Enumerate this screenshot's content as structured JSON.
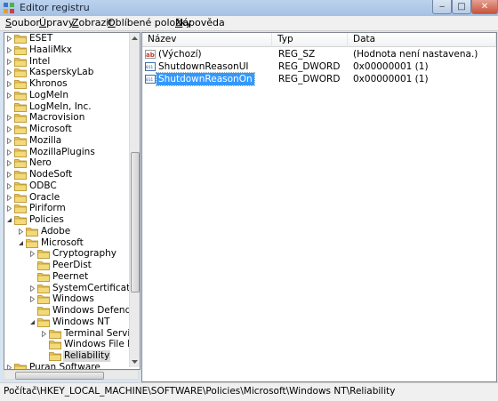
{
  "window": {
    "title": "Editor registru",
    "controls": {
      "minimize": "‒",
      "maximize": "□",
      "close": "✕"
    }
  },
  "menu": [
    {
      "pre": "",
      "u": "S",
      "post": "oubor"
    },
    {
      "pre": "",
      "u": "Ú",
      "post": "pravy"
    },
    {
      "pre": "",
      "u": "Z",
      "post": "obrazit"
    },
    {
      "pre": "",
      "u": "O",
      "post": "blíbené položky"
    },
    {
      "pre": "",
      "u": "N",
      "post": "ápověda"
    }
  ],
  "tree": [
    {
      "label": "ESET",
      "indent": 0,
      "expander": "collapsed",
      "selected": false
    },
    {
      "label": "HaaliMkx",
      "indent": 0,
      "expander": "collapsed",
      "selected": false
    },
    {
      "label": "Intel",
      "indent": 0,
      "expander": "collapsed",
      "selected": false
    },
    {
      "label": "KasperskyLab",
      "indent": 0,
      "expander": "collapsed",
      "selected": false
    },
    {
      "label": "Khronos",
      "indent": 0,
      "expander": "collapsed",
      "selected": false
    },
    {
      "label": "LogMeIn",
      "indent": 0,
      "expander": "collapsed",
      "selected": false
    },
    {
      "label": "LogMeIn, Inc.",
      "indent": 0,
      "expander": "none",
      "selected": false
    },
    {
      "label": "Macrovision",
      "indent": 0,
      "expander": "collapsed",
      "selected": false
    },
    {
      "label": "Microsoft",
      "indent": 0,
      "expander": "collapsed",
      "selected": false
    },
    {
      "label": "Mozilla",
      "indent": 0,
      "expander": "collapsed",
      "selected": false
    },
    {
      "label": "MozillaPlugins",
      "indent": 0,
      "expander": "collapsed",
      "selected": false
    },
    {
      "label": "Nero",
      "indent": 0,
      "expander": "collapsed",
      "selected": false
    },
    {
      "label": "NodeSoft",
      "indent": 0,
      "expander": "collapsed",
      "selected": false
    },
    {
      "label": "ODBC",
      "indent": 0,
      "expander": "collapsed",
      "selected": false
    },
    {
      "label": "Oracle",
      "indent": 0,
      "expander": "collapsed",
      "selected": false
    },
    {
      "label": "Piriform",
      "indent": 0,
      "expander": "collapsed",
      "selected": false
    },
    {
      "label": "Policies",
      "indent": 0,
      "expander": "expanded",
      "selected": false
    },
    {
      "label": "Adobe",
      "indent": 1,
      "expander": "collapsed",
      "selected": false
    },
    {
      "label": "Microsoft",
      "indent": 1,
      "expander": "expanded",
      "selected": false
    },
    {
      "label": "Cryptography",
      "indent": 2,
      "expander": "collapsed",
      "selected": false
    },
    {
      "label": "PeerDist",
      "indent": 2,
      "expander": "none",
      "selected": false
    },
    {
      "label": "Peernet",
      "indent": 2,
      "expander": "none",
      "selected": false
    },
    {
      "label": "SystemCertificates",
      "indent": 2,
      "expander": "collapsed",
      "selected": false
    },
    {
      "label": "Windows",
      "indent": 2,
      "expander": "collapsed",
      "selected": false
    },
    {
      "label": "Windows Defender",
      "indent": 2,
      "expander": "none",
      "selected": false
    },
    {
      "label": "Windows NT",
      "indent": 2,
      "expander": "expanded",
      "selected": false
    },
    {
      "label": "Terminal Services",
      "indent": 3,
      "expander": "collapsed",
      "selected": false
    },
    {
      "label": "Windows File Prote",
      "indent": 3,
      "expander": "none",
      "selected": false
    },
    {
      "label": "Reliability",
      "indent": 3,
      "expander": "none",
      "selected": true
    },
    {
      "label": "Puran Software",
      "indent": 0,
      "expander": "collapsed",
      "selected": false
    }
  ],
  "list": {
    "columns": [
      "Název",
      "Typ",
      "Data"
    ],
    "rows": [
      {
        "icon": "string-value-icon",
        "name": "(Výchozí)",
        "type": "REG_SZ",
        "data": "(Hodnota není nastavena.)",
        "selected": false
      },
      {
        "icon": "dword-value-icon",
        "name": "ShutdownReasonUI",
        "type": "REG_DWORD",
        "data": "0x00000001 (1)",
        "selected": false
      },
      {
        "icon": "dword-value-icon",
        "name": "ShutdownReasonOn",
        "type": "REG_DWORD",
        "data": "0x00000001 (1)",
        "selected": true
      }
    ]
  },
  "status": "Počítač\\HKEY_LOCAL_MACHINE\\SOFTWARE\\Policies\\Microsoft\\Windows NT\\Reliability",
  "colors": {
    "folder": "#e8c45a",
    "selection": "#3399ff",
    "tree_selection": "#d9d9d9"
  }
}
